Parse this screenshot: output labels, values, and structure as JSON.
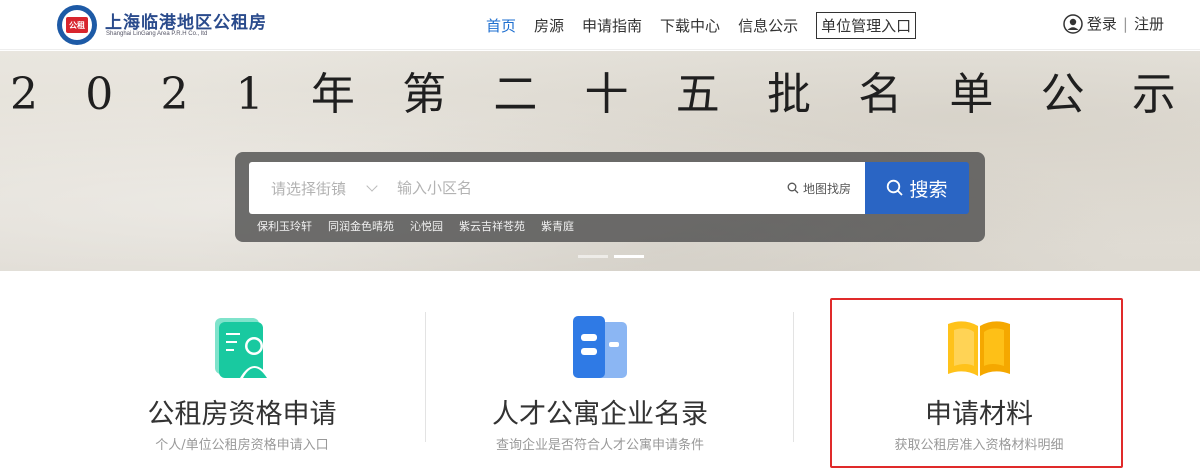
{
  "header": {
    "logo_text": "公租",
    "site_name": "上海临港地区公租房",
    "site_sub": "Shanghai LinGang Area P.R.H Co., ltd",
    "nav": [
      {
        "label": "首页",
        "active": true
      },
      {
        "label": "房源",
        "active": false
      },
      {
        "label": "申请指南",
        "active": false
      },
      {
        "label": "下载中心",
        "active": false
      },
      {
        "label": "信息公示",
        "active": false
      },
      {
        "label": "单位管理入口",
        "active": false
      }
    ],
    "login_label": "登录",
    "separator": "|",
    "register_label": "注册"
  },
  "banner": {
    "title_chars": [
      "2",
      "0",
      "2",
      "1",
      "年",
      "第",
      "二",
      "十",
      "五",
      "批",
      "名",
      "单",
      "公",
      "示"
    ],
    "search": {
      "street_placeholder": "请选择街镇",
      "community_placeholder": "输入小区名",
      "map_label": "地图找房",
      "button_label": "搜索"
    },
    "hot_tags": [
      "保利玉玲轩",
      "同润金色晴苑",
      "沁悦园",
      "紫云吉祥苍苑",
      "紫青庭"
    ],
    "slides": [
      false,
      true
    ]
  },
  "cards": [
    {
      "title": "公租房资格申请",
      "subtitle": "个人/单位公租房资格申请入口"
    },
    {
      "title": "人才公寓企业名录",
      "subtitle": "查询企业是否符合人才公寓申请条件"
    },
    {
      "title": "申请材料",
      "subtitle": "获取公租房准入资格材料明细"
    }
  ],
  "colors": {
    "accent": "#2a65c4",
    "nav_active": "#1e6fd0",
    "highlight": "#e02a2a"
  }
}
